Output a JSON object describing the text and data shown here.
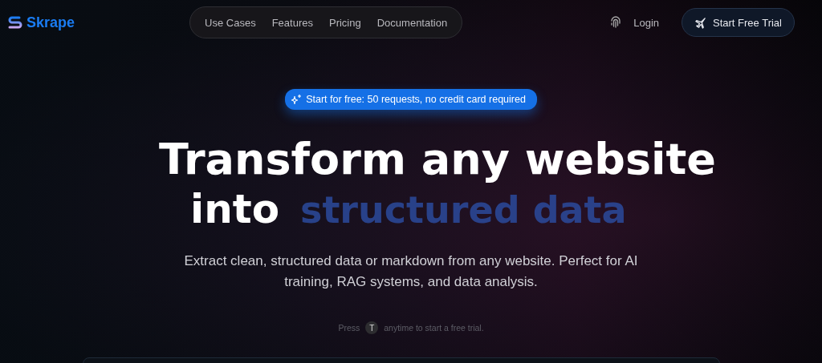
{
  "brand": {
    "name": "Skrape"
  },
  "nav": {
    "links": [
      {
        "label": "Use Cases"
      },
      {
        "label": "Features"
      },
      {
        "label": "Pricing"
      },
      {
        "label": "Documentation"
      }
    ],
    "login": "Login",
    "cta": "Start Free Trial"
  },
  "hero": {
    "badge": "Start for free: 50 requests, no credit card required",
    "title_line1": "Transform any website",
    "title_line2_lead": "into",
    "title_line2_rotating": "structured data",
    "subtitle": "Extract clean, structured data or markdown from any website. Perfect for AI training, RAG systems, and data analysis.",
    "hint_before": "Press",
    "hint_key": "T",
    "hint_after": "anytime to start a free trial."
  }
}
